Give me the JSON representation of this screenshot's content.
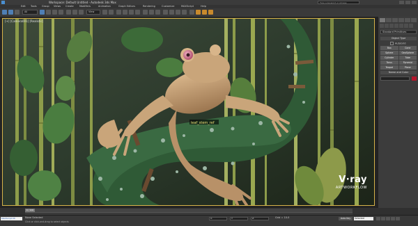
{
  "app": {
    "title": "Workspace: Default   Untitled - Autodesk 3ds Max",
    "search_placeholder": "Type a keyword or phrase"
  },
  "menu": [
    {
      "label": "Edit"
    },
    {
      "label": "Tools"
    },
    {
      "label": "Group"
    },
    {
      "label": "Views"
    },
    {
      "label": "Create"
    },
    {
      "label": "Modifiers"
    },
    {
      "label": "Animation"
    },
    {
      "label": "Graph Editors"
    },
    {
      "label": "Rendering"
    },
    {
      "label": "Customize"
    },
    {
      "label": "MAXScript"
    },
    {
      "label": "Help"
    }
  ],
  "toolbar": {
    "selection_filter": "All",
    "reference_coord": "View"
  },
  "viewport": {
    "label": "[+] [Camera001] [Realistic]",
    "object_label": "leaf_stem_ref",
    "branding": {
      "line1": "V·ray",
      "line2": "ARTWORKFLOW"
    }
  },
  "command_panel": {
    "category_dropdown": "Standard Primitives",
    "object_type_header": "Object Type",
    "autogrid_label": "AutoGrid",
    "buttons": [
      "Box",
      "Cone",
      "Sphere",
      "GeoSphere",
      "Cylinder",
      "Tube",
      "Torus",
      "Pyramid",
      "Teapot",
      "Plane"
    ],
    "name_color_header": "Name and Color",
    "color_hex": "#b2162c"
  },
  "timeline": {
    "frame_display": "0 / 100"
  },
  "status": {
    "maxscript_label": "MAXScript Mi",
    "selection_text": "None Selected",
    "hint_text": "Click or click-and-drag to select objects",
    "coords": {
      "x_label": "X:",
      "y_label": "Y:",
      "z_label": "Z:"
    },
    "grid_text": "Grid = 10.0",
    "autokey_label": "Auto Key",
    "selected_dropdown": "Selected"
  }
}
